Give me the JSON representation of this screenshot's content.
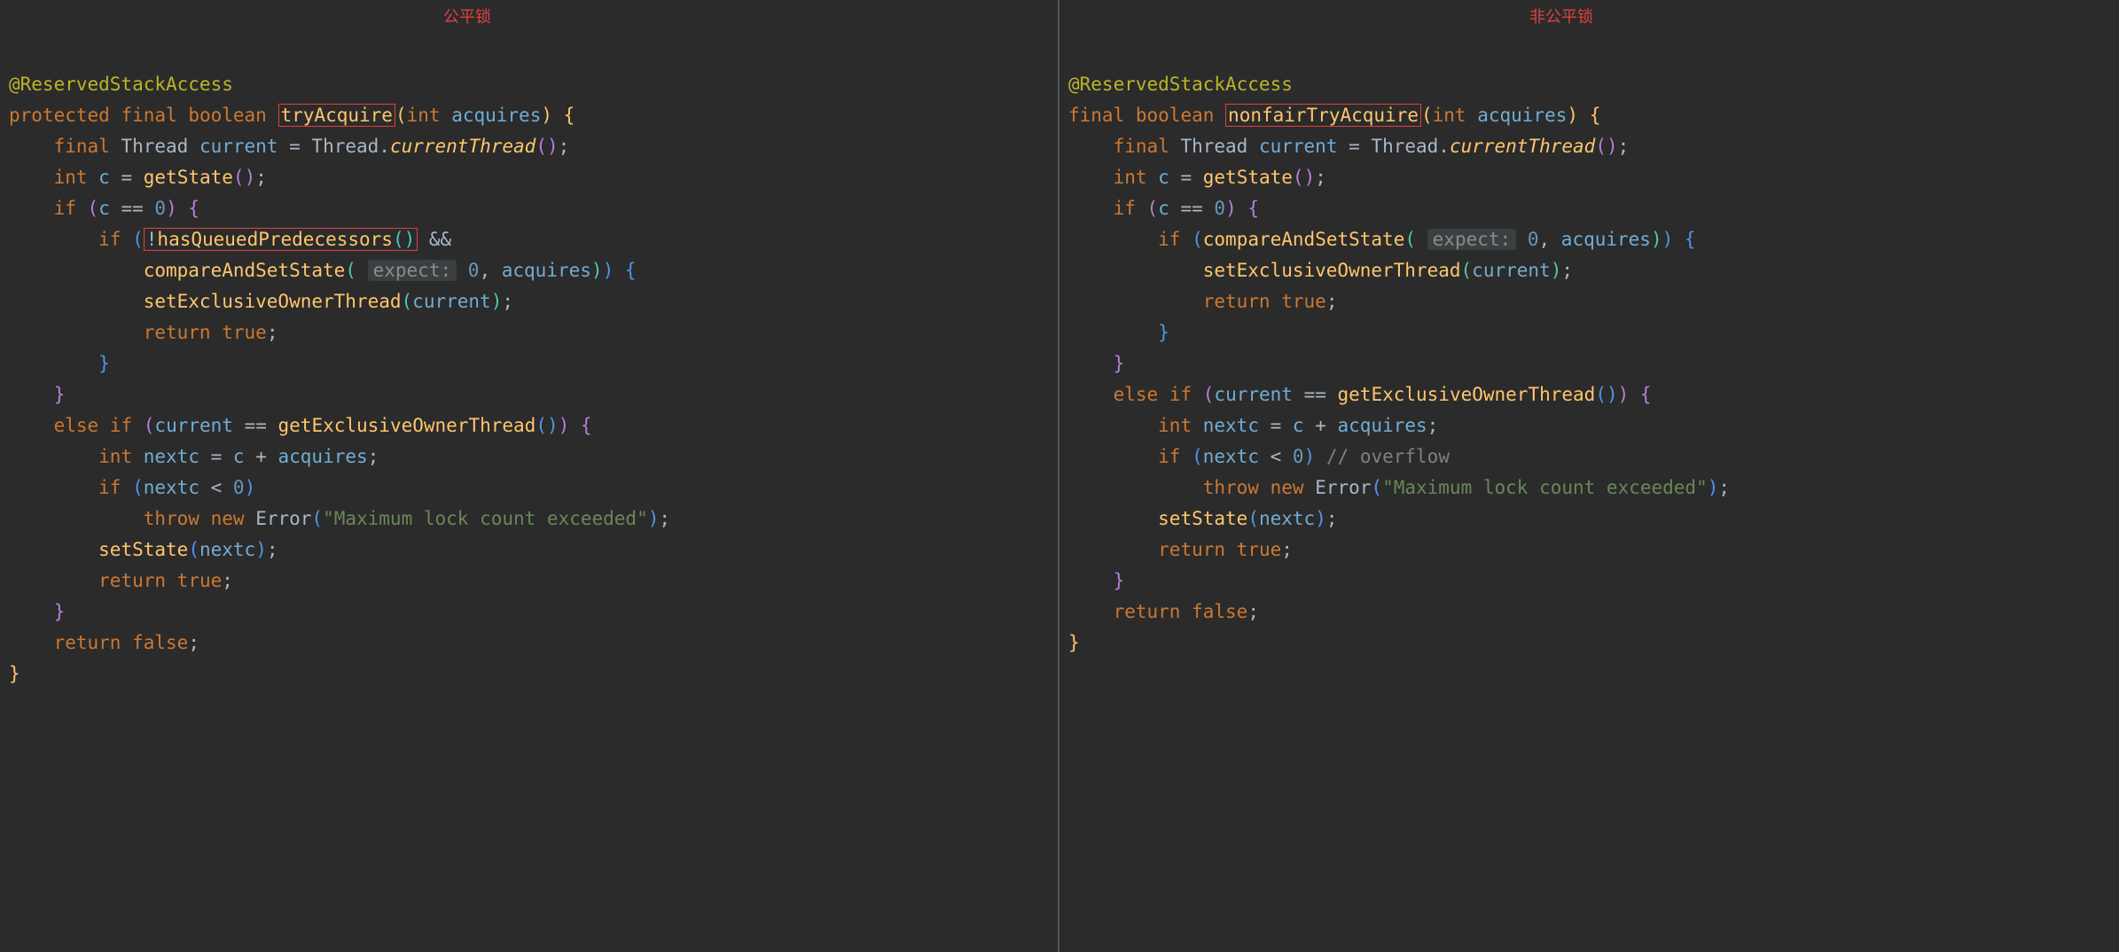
{
  "left": {
    "label": "公平锁",
    "annotation": "@ReservedStackAccess",
    "sig_protected": "protected",
    "sig_final": "final",
    "sig_boolean": "boolean",
    "method_name": "tryAcquire",
    "sig_int": "int",
    "sig_param": "acquires",
    "l1_final": "final",
    "l1_thread": "Thread",
    "l1_current": "current",
    "l1_eq": " = ",
    "l1_thread2": "Thread",
    "l1_dot": ".",
    "l1_currentThread": "currentThread",
    "l2_int": "int",
    "l2_c": "c",
    "l2_getState": "getState",
    "l3_if": "if",
    "l3_c": "c",
    "l3_eqeq": " == ",
    "l3_zero": "0",
    "l4_if": "if",
    "l4_not": "!",
    "l4_hasQueued": "hasQueuedPredecessors",
    "l4_andand": " &&",
    "l5_cas": "compareAndSetState",
    "l5_hint": "expect:",
    "l5_zero": "0",
    "l5_acquires": "acquires",
    "l6_setExcl": "setExclusiveOwnerThread",
    "l6_current": "current",
    "l7_return": "return",
    "l7_true": "true",
    "l8_else": "else",
    "l8_if": "if",
    "l8_current": "current",
    "l8_eqeq": " == ",
    "l8_getExcl": "getExclusiveOwnerThread",
    "l9_int": "int",
    "l9_nextc": "nextc",
    "l9_c": "c",
    "l9_plus": " + ",
    "l9_acquires": "acquires",
    "l10_if": "if",
    "l10_nextc": "nextc",
    "l10_lt": " < ",
    "l10_zero": "0",
    "l11_throw": "throw",
    "l11_new": "new",
    "l11_error": "Error",
    "l11_msg": "\"Maximum lock count exceeded\"",
    "l12_setState": "setState",
    "l12_nextc": "nextc",
    "l13_return": "return",
    "l13_true": "true",
    "l14_return": "return",
    "l14_false": "false"
  },
  "right": {
    "label": "非公平锁",
    "annotation": "@ReservedStackAccess",
    "sig_final": "final",
    "sig_boolean": "boolean",
    "method_name": "nonfairTryAcquire",
    "sig_int": "int",
    "sig_param": "acquires",
    "l1_final": "final",
    "l1_thread": "Thread",
    "l1_current": "current",
    "l1_thread2": "Thread",
    "l1_currentThread": "currentThread",
    "l2_int": "int",
    "l2_c": "c",
    "l2_getState": "getState",
    "l3_if": "if",
    "l3_c": "c",
    "l3_zero": "0",
    "l4_if": "if",
    "l4_cas": "compareAndSetState",
    "l4_hint": "expect:",
    "l4_zero": "0",
    "l4_acquires": "acquires",
    "l5_setExcl": "setExclusiveOwnerThread",
    "l5_current": "current",
    "l6_return": "return",
    "l6_true": "true",
    "l8_else": "else",
    "l8_if": "if",
    "l8_current": "current",
    "l8_getExcl": "getExclusiveOwnerThread",
    "l9_int": "int",
    "l9_nextc": "nextc",
    "l9_c": "c",
    "l9_acquires": "acquires",
    "l10_if": "if",
    "l10_nextc": "nextc",
    "l10_zero": "0",
    "l10_comment": "// overflow",
    "l11_throw": "throw",
    "l11_new": "new",
    "l11_error": "Error",
    "l11_msg": "\"Maximum lock count exceeded\"",
    "l12_setState": "setState",
    "l12_nextc": "nextc",
    "l13_return": "return",
    "l13_true": "true",
    "l14_return": "return",
    "l14_false": "false"
  }
}
